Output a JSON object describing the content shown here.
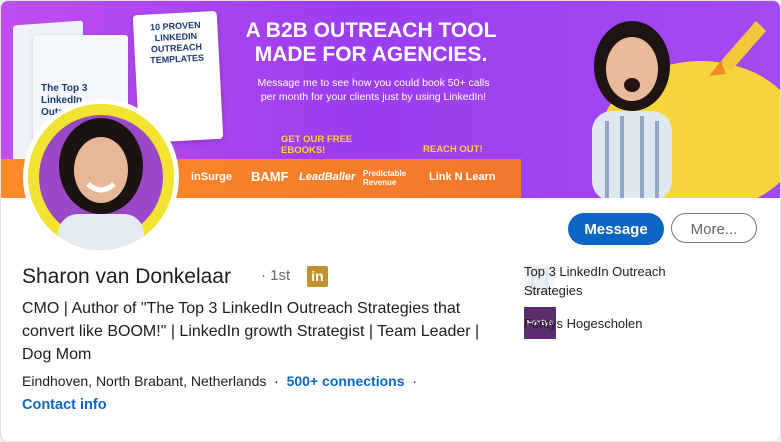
{
  "banner": {
    "headline": "A B2B OUTREACH TOOL MADE FOR AGENCIES.",
    "subtext": "Message me to see how you could book 50+ calls per month for your clients just by using LinkedIn!",
    "cta_ebooks": "GET OUR FREE EBOOKS!",
    "cta_reach": "REACH OUT!",
    "book_small": "The Top 3 LinkedIn Outreach",
    "book_main": "10 PROVEN LINKEDIN OUTREACH TEMPLATES",
    "partners": [
      "inSurge",
      "BAMF",
      "LeadBaller",
      "Predictable Revenue",
      "Link N Learn"
    ]
  },
  "profile": {
    "name": "Sharon van Donkelaar",
    "degree": "· 1st",
    "headline": "CMO | Author of \"The Top 3 LinkedIn Outreach Strategies that convert like BOOM!\" | LinkedIn growth Strategist | Team Leader | Dog Mom",
    "location": "Eindhoven, North Brabant, Netherlands",
    "connections": "500+ connections",
    "contact_info": "Contact info"
  },
  "actions": {
    "message": "Message",
    "more": "More..."
  },
  "education": [
    {
      "label": "Top 3 LinkedIn Outreach Strategies"
    },
    {
      "label": "Fontys Hogescholen",
      "logo_text": "Fontys"
    }
  ],
  "colors": {
    "accent": "#0a66c2",
    "banner": "#a44af2",
    "avatar_bg": "#f1e330"
  }
}
